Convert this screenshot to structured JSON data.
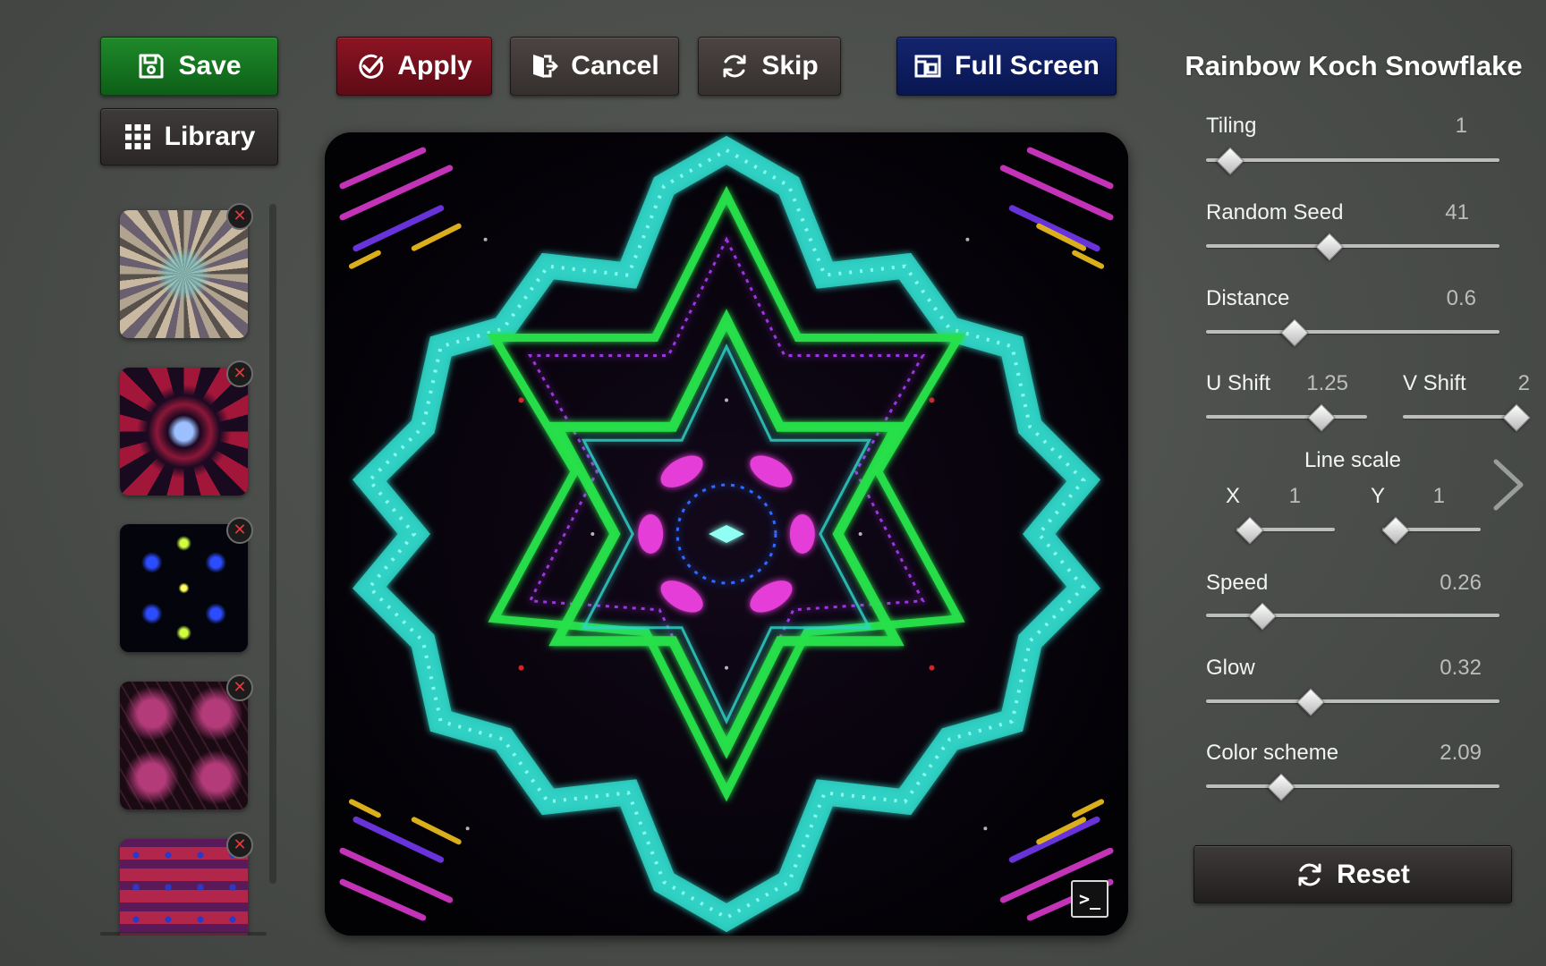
{
  "toolbar": {
    "save_label": "Save",
    "apply_label": "Apply",
    "cancel_label": "Cancel",
    "skip_label": "Skip",
    "fullscreen_label": "Full Screen",
    "library_label": "Library"
  },
  "thumbnails": {
    "remove_glyph": "✕",
    "count_visible": 5
  },
  "preview": {
    "console_label": ">_"
  },
  "panel": {
    "title": "Rainbow Koch Snowflake",
    "params": {
      "tiling": {
        "label": "Tiling",
        "value": "1",
        "fraction": 0.04
      },
      "random_seed": {
        "label": "Random Seed",
        "value": "41",
        "fraction": 0.41
      },
      "distance": {
        "label": "Distance",
        "value": "0.6",
        "fraction": 0.28
      },
      "u_shift": {
        "label": "U Shift",
        "value": "1.25",
        "fraction": 0.75
      },
      "v_shift": {
        "label": "V Shift",
        "value": "2",
        "fraction": 1.0
      },
      "line_scale": {
        "label": "Line scale"
      },
      "line_scale_x": {
        "label": "X",
        "value": "1",
        "fraction": 0.0
      },
      "line_scale_y": {
        "label": "Y",
        "value": "1",
        "fraction": 0.0
      },
      "speed": {
        "label": "Speed",
        "value": "0.26",
        "fraction": 0.16
      },
      "glow": {
        "label": "Glow",
        "value": "0.32",
        "fraction": 0.34
      },
      "color_scheme": {
        "label": "Color scheme",
        "value": "2.09",
        "fraction": 0.23
      }
    },
    "reset_label": "Reset"
  },
  "colors": {
    "save": "#15721f",
    "apply": "#7a0f1e",
    "fullscreen": "#0c1b60",
    "neutral": "#403a38",
    "snowflake_cyan": "#2fd6c8",
    "snowflake_green": "#27e04a",
    "snowflake_magenta": "#e43cd8"
  },
  "icons": {
    "save": "floppy-disk-icon",
    "apply": "check-circle-icon",
    "cancel": "exit-door-icon",
    "skip": "refresh-icon",
    "fullscreen": "fullscreen-window-icon",
    "library": "grid-icon",
    "reset": "refresh-icon",
    "next": "chevron-right-icon"
  }
}
